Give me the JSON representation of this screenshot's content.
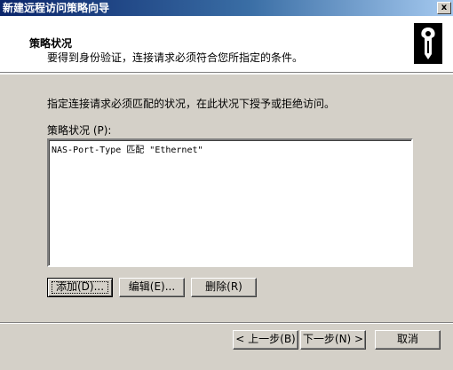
{
  "window": {
    "title": "新建远程访问策略向导",
    "close_label": "x"
  },
  "header": {
    "title": "策略状况",
    "subtitle": "要得到身份验证，连接请求必须符合您所指定的条件。",
    "icon": "key-lock-icon"
  },
  "content": {
    "instruction": "指定连接请求必须匹配的状况，在此状况下授予或拒绝访问。",
    "list_label": "策略状况 (P):",
    "conditions": [
      "NAS-Port-Type 匹配 \"Ethernet\""
    ]
  },
  "buttons": {
    "add": "添加(D)...",
    "edit": "编辑(E)...",
    "delete": "删除(R)"
  },
  "nav": {
    "back": "< 上一步(B)",
    "next": "下一步(N) >",
    "cancel": "取消"
  },
  "colors": {
    "titlebar_start": "#0a246a",
    "titlebar_end": "#a6caf0",
    "dialog_bg": "#d4d0c8"
  }
}
